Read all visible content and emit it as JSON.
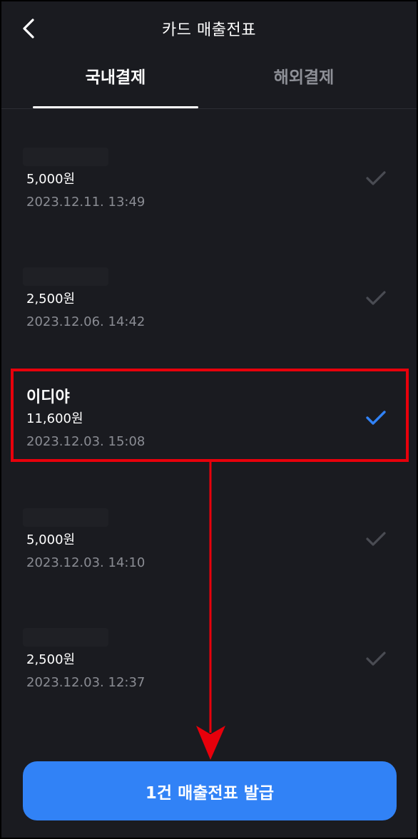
{
  "header": {
    "title": "카드 매출전표",
    "back_icon": "chevron-left-icon"
  },
  "tabs": [
    {
      "label": "국내결제",
      "active": true
    },
    {
      "label": "해외결제",
      "active": false
    }
  ],
  "transactions": [
    {
      "store": "",
      "amount": "5,000원",
      "date": "2023.12.11. 13:49",
      "selected": false
    },
    {
      "store": "",
      "amount": "2,500원",
      "date": "2023.12.06. 14:42",
      "selected": false
    },
    {
      "store": "이디야",
      "amount": "11,600원",
      "date": "2023.12.03. 15:08",
      "selected": true
    },
    {
      "store": "",
      "amount": "5,000원",
      "date": "2023.12.03. 14:10",
      "selected": false
    },
    {
      "store": "",
      "amount": "2,500원",
      "date": "2023.12.03. 12:37",
      "selected": false
    }
  ],
  "issue_button": {
    "label": "1건 매출전표 발급"
  },
  "colors": {
    "background": "#1a1b20",
    "accent": "#3182f6",
    "check_selected": "#3182f6",
    "check_unselected": "#4a4c53",
    "annotation": "#e8000b",
    "secondary_text": "#8a8c93"
  }
}
